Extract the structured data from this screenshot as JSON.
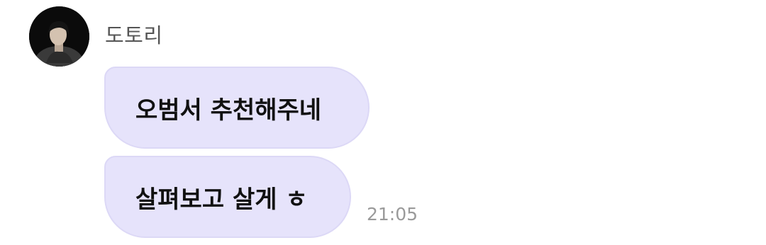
{
  "chat": {
    "sender": {
      "name": "도토리"
    },
    "messages": [
      {
        "text": "오범서 추천해주네"
      },
      {
        "text": "살펴보고 살게 ㅎ"
      }
    ],
    "timestamp": "21:05"
  },
  "colors": {
    "bubble_bg": "#e6e3fb",
    "name_text": "#555555",
    "time_text": "#9a9a9a"
  }
}
